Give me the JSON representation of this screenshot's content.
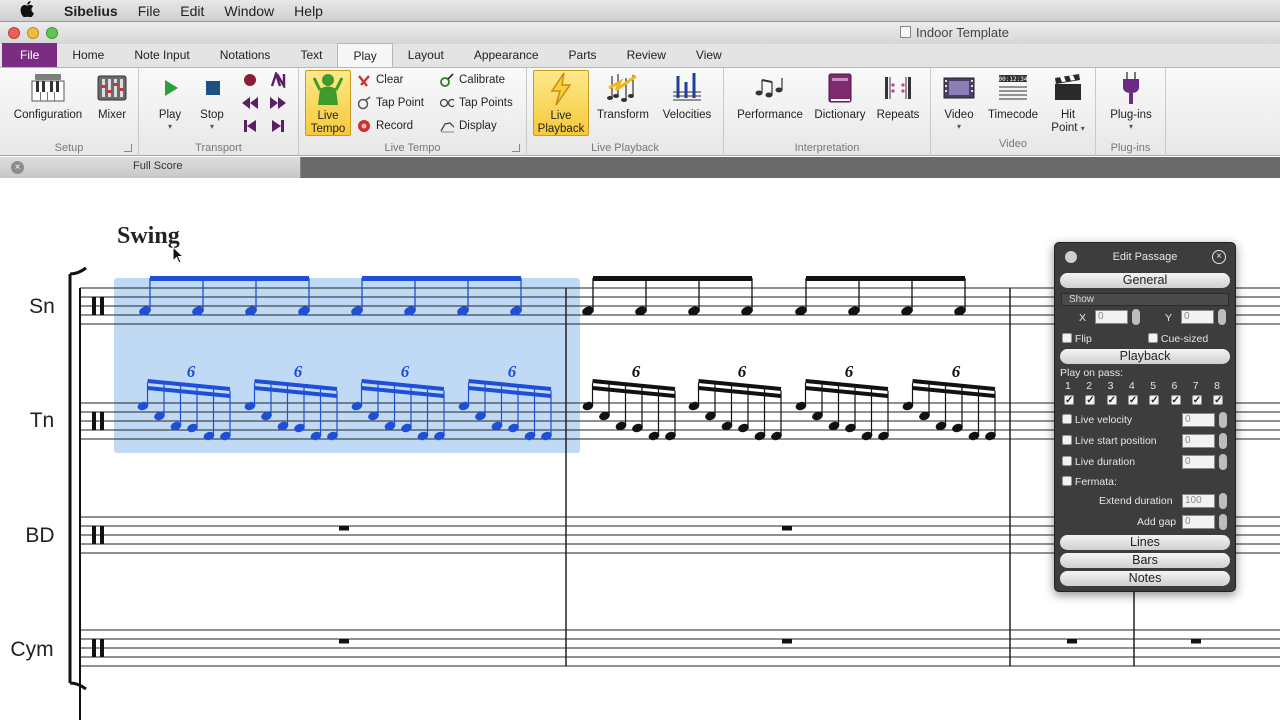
{
  "menubar": {
    "apple": "",
    "app": "Sibelius",
    "items": [
      "File",
      "Edit",
      "Window",
      "Help"
    ]
  },
  "window": {
    "title": "Indoor Template"
  },
  "tabs": [
    "File",
    "Home",
    "Note Input",
    "Notations",
    "Text",
    "Play",
    "Layout",
    "Appearance",
    "Parts",
    "Review",
    "View"
  ],
  "active_tab": "Play",
  "ribbon": {
    "setup": {
      "label": "Setup",
      "configuration": "Configuration",
      "mixer": "Mixer"
    },
    "transport": {
      "label": "Transport",
      "play": "Play",
      "stop": "Stop"
    },
    "live_tempo": {
      "label": "Live Tempo",
      "live_tempo_l1": "Live",
      "live_tempo_l2": "Tempo",
      "clear": "Clear",
      "tap_point": "Tap Point",
      "record": "Record",
      "calibrate": "Calibrate",
      "tap_points": "Tap Points",
      "display": "Display"
    },
    "live_playback": {
      "label": "Live Playback",
      "live_playback_l1": "Live",
      "live_playback_l2": "Playback",
      "transform": "Transform",
      "velocities": "Velocities"
    },
    "interpretation": {
      "label": "Interpretation",
      "performance": "Performance",
      "dictionary": "Dictionary",
      "repeats": "Repeats"
    },
    "video": {
      "label": "Video",
      "video": "Video",
      "timecode": "Timecode",
      "hit_l1": "Hit",
      "hit_l2": "Point"
    },
    "plugins": {
      "label": "Plug-ins",
      "plugins": "Plug-ins"
    }
  },
  "score_tab": {
    "close": "×",
    "label": "Full Score"
  },
  "score": {
    "tempo_text": "Swing",
    "instruments": [
      "Sn",
      "Tn",
      "BD",
      "Cym"
    ],
    "tuplet": "6"
  },
  "edit_passage": {
    "title": "Edit Passage",
    "close": "×",
    "sections": {
      "general": "General",
      "playback": "Playback",
      "lines": "Lines",
      "bars": "Bars",
      "notes": "Notes"
    },
    "show_label": "Show",
    "x_label": "X",
    "x_value": "0",
    "y_label": "Y",
    "y_value": "0",
    "flip": "Flip",
    "cue_sized": "Cue-sized",
    "play_on_pass": "Play on pass:",
    "passes": [
      "1",
      "2",
      "3",
      "4",
      "5",
      "6",
      "7",
      "8"
    ],
    "live_velocity": "Live velocity",
    "live_velocity_value": "0",
    "live_start": "Live start position",
    "live_start_value": "0",
    "live_duration": "Live duration",
    "live_duration_value": "0",
    "fermata": "Fermata:",
    "extend_duration": "Extend duration",
    "extend_duration_value": "100",
    "add_gap": "Add gap",
    "add_gap_value": "0"
  },
  "colors": {
    "file_tab": "#7a2e83",
    "selection": "#b5d4f4",
    "selected_notes": "#1e4fd6",
    "panel_bg": "#3d3d3d",
    "highlight": "#f6c93a"
  }
}
